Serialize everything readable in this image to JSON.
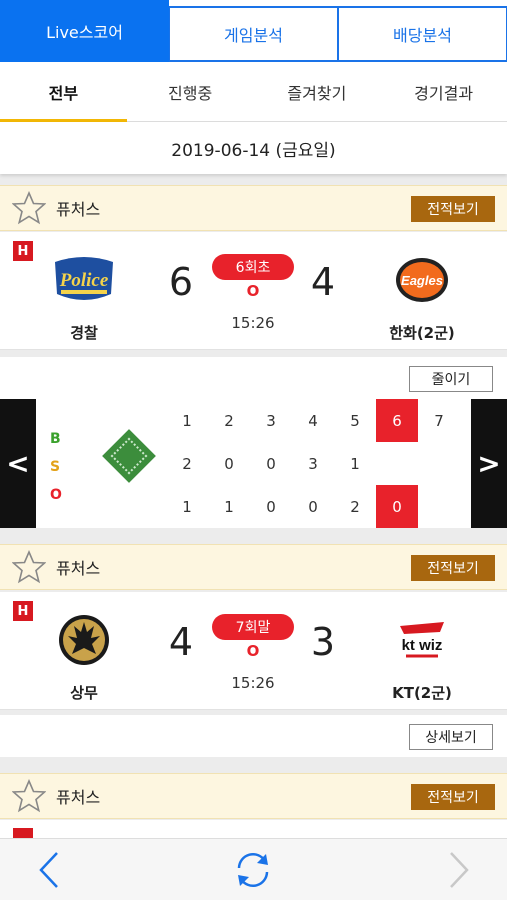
{
  "top_tabs": [
    {
      "label": "Live스코어"
    },
    {
      "label": "게임분석"
    },
    {
      "label": "배당분석"
    }
  ],
  "sub_tabs": [
    {
      "label": "전부"
    },
    {
      "label": "진행중"
    },
    {
      "label": "즐겨찾기"
    },
    {
      "label": "경기결과"
    }
  ],
  "date": "2019-06-14 (금요일)",
  "games": [
    {
      "league": "퓨처스",
      "record_button": "전적보기",
      "badge": "H",
      "home_team": "경찰",
      "home_logo_text": "Police",
      "home_score": "6",
      "away_team": "한화(2군)",
      "away_logo_text": "Eagles",
      "away_score": "4",
      "inning": "6회초",
      "indicator": "O",
      "time": "15:26",
      "action_button": "줄이기"
    },
    {
      "league": "퓨처스",
      "record_button": "전적보기",
      "badge": "H",
      "home_team": "상무",
      "home_score": "4",
      "away_team": "KT(2군)",
      "away_logo_text": "kt wiz",
      "away_score": "3",
      "inning": "7회말",
      "indicator": "O",
      "time": "15:26",
      "action_button": "상세보기"
    },
    {
      "league": "퓨처스",
      "record_button": "전적보기"
    }
  ],
  "scoreboard": {
    "bso": [
      "B",
      "S",
      "O"
    ],
    "innings": [
      "1",
      "2",
      "3",
      "4",
      "5",
      "6",
      "7"
    ],
    "home_row": [
      "2",
      "0",
      "0",
      "3",
      "1",
      "",
      ""
    ],
    "away_row": [
      "1",
      "1",
      "0",
      "0",
      "2",
      "0",
      ""
    ],
    "highlight_inning": "6",
    "prev_arrow": "<",
    "next_arrow": ">"
  },
  "colors": {
    "primary": "#0a72f0",
    "live_red": "#e8222b",
    "record_brown": "#a8670f",
    "league_bg": "#fdf6e0"
  }
}
